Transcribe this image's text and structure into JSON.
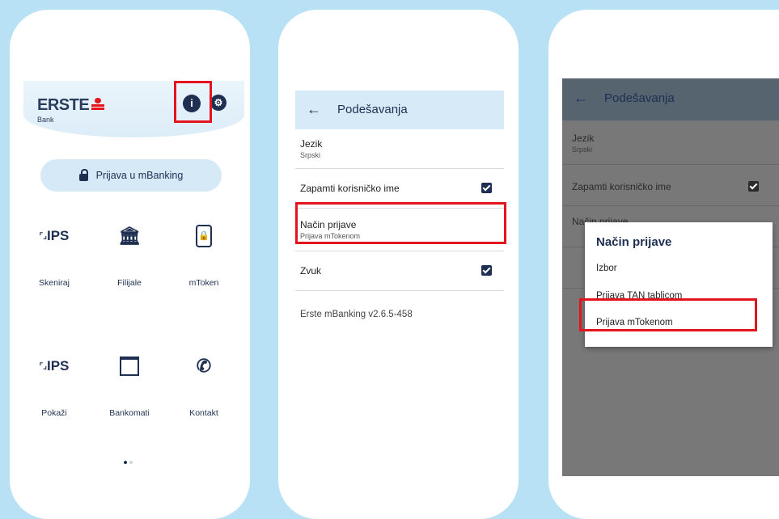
{
  "home": {
    "logo_text": "ERSTE",
    "logo_sub": "Bank",
    "info_icon": "info-icon",
    "settings_icon": "gear-icon",
    "login_label": "Prijava u mBanking",
    "tiles": [
      {
        "label": "Skeniraj",
        "icon": "ips-icon"
      },
      {
        "label": "Filijale",
        "icon": "bank-building-icon"
      },
      {
        "label": "mToken",
        "icon": "mtoken-icon"
      },
      {
        "label": "Pokaži",
        "icon": "ips-icon"
      },
      {
        "label": "Bankomati",
        "icon": "atm-icon"
      },
      {
        "label": "Kontakt",
        "icon": "phone-icon"
      }
    ],
    "ips_text": "IPS"
  },
  "settings": {
    "title": "Podešavanja",
    "language_label": "Jezik",
    "language_value": "Srpski",
    "remember_label": "Zapamti korisničko ime",
    "method_label": "Način prijave",
    "method_value": "Prijava mTokenom",
    "sound_label": "Zvuk",
    "version": "Erste mBanking v2.6.5-458"
  },
  "dialog": {
    "screen_title": "Podešavanja",
    "language_label": "Jezik",
    "language_value": "Srpski",
    "remember_label": "Zapamti korisničko ime",
    "method_label": "Način prijave",
    "title": "Način prijave",
    "options": [
      "Izbor",
      "Prijava TAN tablicom",
      "Prijava mTokenom"
    ]
  },
  "colors": {
    "background": "#b9e1f6",
    "brand_navy": "#1e2f52",
    "brand_red": "#e3141d",
    "highlight": "#e3141d"
  }
}
